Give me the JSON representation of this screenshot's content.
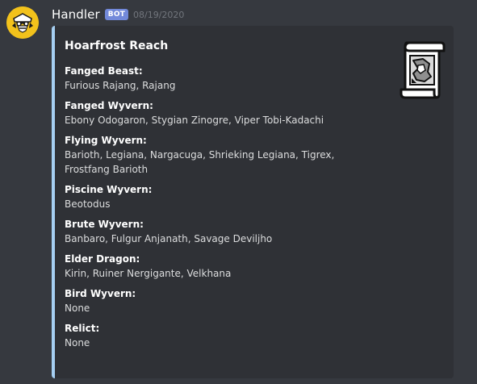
{
  "message": {
    "username": "Handler",
    "bot_tag": "BOT",
    "timestamp": "08/19/2020",
    "avatar_icon": "handler-avatar-icon",
    "colors": {
      "background": "#36393f",
      "embed_background": "#2f3136",
      "embed_accent": "#a6cff2",
      "bot_tag": "#7289da",
      "avatar": "#f2c21c"
    }
  },
  "embed": {
    "title": "Hoarfrost Reach",
    "thumbnail_icon": "region-map-icon",
    "fields": [
      {
        "name": "Fanged Beast:",
        "value": "Furious Rajang, Rajang"
      },
      {
        "name": "Fanged Wyvern:",
        "value": "Ebony Odogaron, Stygian Zinogre, Viper Tobi-Kadachi"
      },
      {
        "name": "Flying Wyvern:",
        "value": "Barioth, Legiana, Nargacuga, Shrieking Legiana, Tigrex, Frostfang Barioth"
      },
      {
        "name": "Piscine Wyvern:",
        "value": "Beotodus"
      },
      {
        "name": "Brute Wyvern:",
        "value": "Banbaro, Fulgur Anjanath, Savage Deviljho"
      },
      {
        "name": "Elder Dragon:",
        "value": "Kirin, Ruiner Nergigante, Velkhana"
      },
      {
        "name": "Bird Wyvern:",
        "value": "None"
      },
      {
        "name": "Relict:",
        "value": "None"
      }
    ]
  }
}
